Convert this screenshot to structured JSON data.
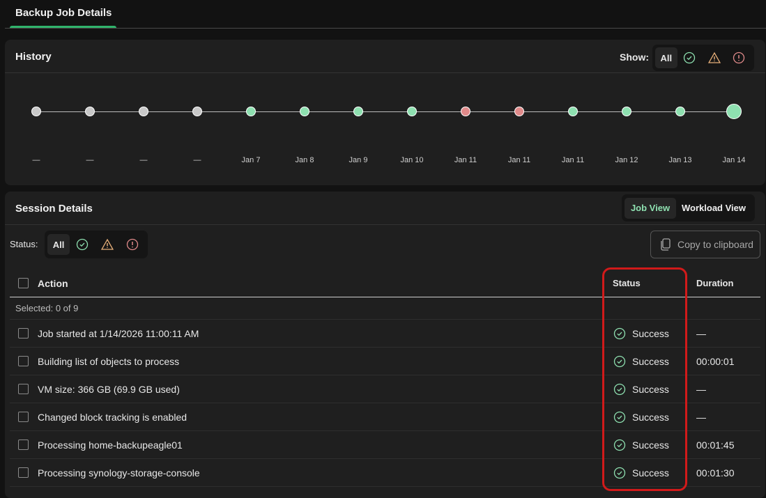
{
  "tab": {
    "title": "Backup Job Details"
  },
  "history": {
    "title": "History",
    "show_label": "Show:",
    "filter_all": "All",
    "points": [
      {
        "label": "—",
        "status": "none"
      },
      {
        "label": "—",
        "status": "none"
      },
      {
        "label": "—",
        "status": "none"
      },
      {
        "label": "—",
        "status": "none"
      },
      {
        "label": "Jan 7",
        "status": "success"
      },
      {
        "label": "Jan 8",
        "status": "success"
      },
      {
        "label": "Jan 9",
        "status": "success"
      },
      {
        "label": "Jan 10",
        "status": "success"
      },
      {
        "label": "Jan 11",
        "status": "failed"
      },
      {
        "label": "Jan 11",
        "status": "failed"
      },
      {
        "label": "Jan 11",
        "status": "success"
      },
      {
        "label": "Jan 12",
        "status": "success"
      },
      {
        "label": "Jan 13",
        "status": "success"
      },
      {
        "label": "Jan 14",
        "status": "success",
        "selected": true
      }
    ]
  },
  "colors": {
    "none": "#c8c8c8",
    "success": "#8ee0b0",
    "failed": "#e08a8a",
    "accent": "#2fb36b"
  },
  "session": {
    "title": "Session Details",
    "job_view": "Job View",
    "workload_view": "Workload View",
    "status_label": "Status:",
    "filter_all": "All",
    "copy": "Copy to clipboard",
    "columns": {
      "action": "Action",
      "status": "Status",
      "duration": "Duration"
    },
    "selected": "Selected:  0 of 9",
    "rows": [
      {
        "action": "Job started at 1/14/2026 11:00:11 AM",
        "status": "Success",
        "duration": "—"
      },
      {
        "action": "Building list of objects to process",
        "status": "Success",
        "duration": "00:00:01"
      },
      {
        "action": "VM size: 366 GB (69.9 GB used)",
        "status": "Success",
        "duration": "—"
      },
      {
        "action": "Changed block tracking is enabled",
        "status": "Success",
        "duration": "—"
      },
      {
        "action": "Processing home-backupeagle01",
        "status": "Success",
        "duration": "00:01:45"
      },
      {
        "action": "Processing synology-storage-console",
        "status": "Success",
        "duration": "00:01:30"
      }
    ]
  }
}
